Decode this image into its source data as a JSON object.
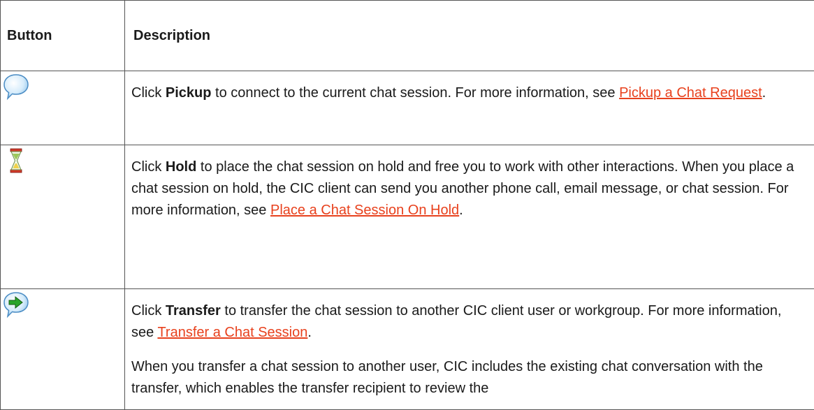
{
  "table": {
    "headers": {
      "button": "Button",
      "description": "Description"
    },
    "rows": [
      {
        "icon": "chat-bubble-icon",
        "pre": "Click ",
        "bold": "Pickup",
        "post": " to connect to the current chat session. For more information, see ",
        "link": "Pickup a Chat Request",
        "end": "."
      },
      {
        "icon": "hourglass-icon",
        "pre": "Click ",
        "bold": "Hold",
        "post": " to place the chat session on hold and free you to work with other interactions. When you place a chat session on hold, the CIC client can send you another phone call, email message, or chat session. For more information, see ",
        "link": "Place a Chat Session On Hold",
        "end": "."
      },
      {
        "icon": "transfer-arrow-icon",
        "pre": "Click ",
        "bold": "Transfer",
        "post": " to transfer the chat session to another CIC client user or workgroup. For more information, see ",
        "link": "Transfer a Chat Session",
        "end": ".",
        "note": "When you transfer a chat session to another user, CIC includes the existing chat conversation with the transfer, which enables the transfer recipient to review the"
      }
    ]
  },
  "colors": {
    "link": "#e8411d",
    "border": "#555555"
  }
}
